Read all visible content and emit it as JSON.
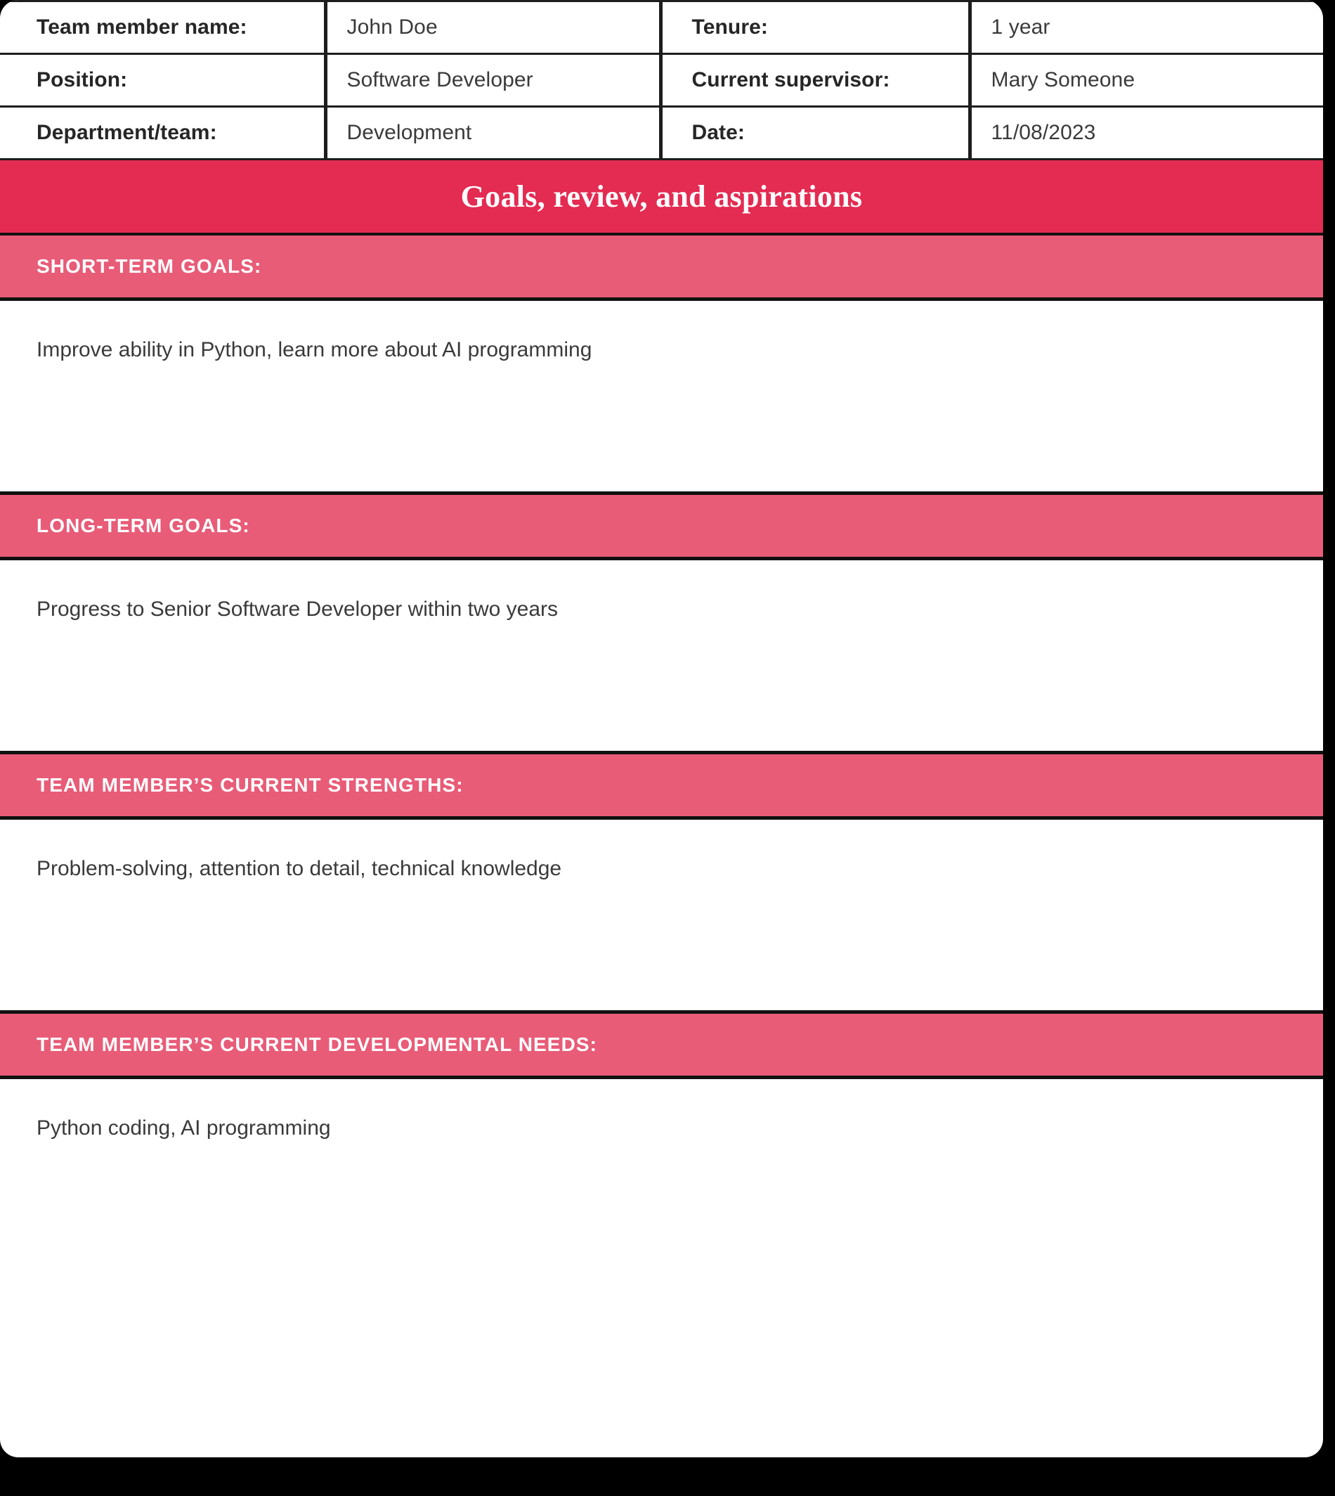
{
  "info_table": {
    "rows": [
      {
        "label_left": "Team member name:",
        "value_left": "John Doe",
        "label_right": "Tenure:",
        "value_right": "1 year"
      },
      {
        "label_left": "Position:",
        "value_left": "Software Developer",
        "label_right": "Current supervisor:",
        "value_right": "Mary Someone"
      },
      {
        "label_left": "Department/team:",
        "value_left": "Development",
        "label_right": "Date:",
        "value_right": "11/08/2023"
      }
    ]
  },
  "banner": {
    "title": "Goals, review, and aspirations",
    "background_color": "#E42B52",
    "text_color": "#FFFFFF"
  },
  "sections": [
    {
      "header": "SHORT-TERM GOALS:",
      "content": "Improve ability in Python, learn more about AI programming"
    },
    {
      "header": "LONG-TERM GOALS:",
      "content": "Progress to Senior Software Developer within two years"
    },
    {
      "header": "TEAM MEMBER’S CURRENT STRENGTHS:",
      "content": "Problem-solving, attention to detail, technical knowledge"
    },
    {
      "header": "TEAM MEMBER’S CURRENT DEVELOPMENTAL NEEDS:",
      "content": "Python coding, AI programming"
    }
  ],
  "theme": {
    "banner_red": "#E42B52",
    "section_header_pink": "#E85C78",
    "rule_black": "#111111",
    "body_text": "#3A3A3A",
    "page_background": "#000000"
  }
}
